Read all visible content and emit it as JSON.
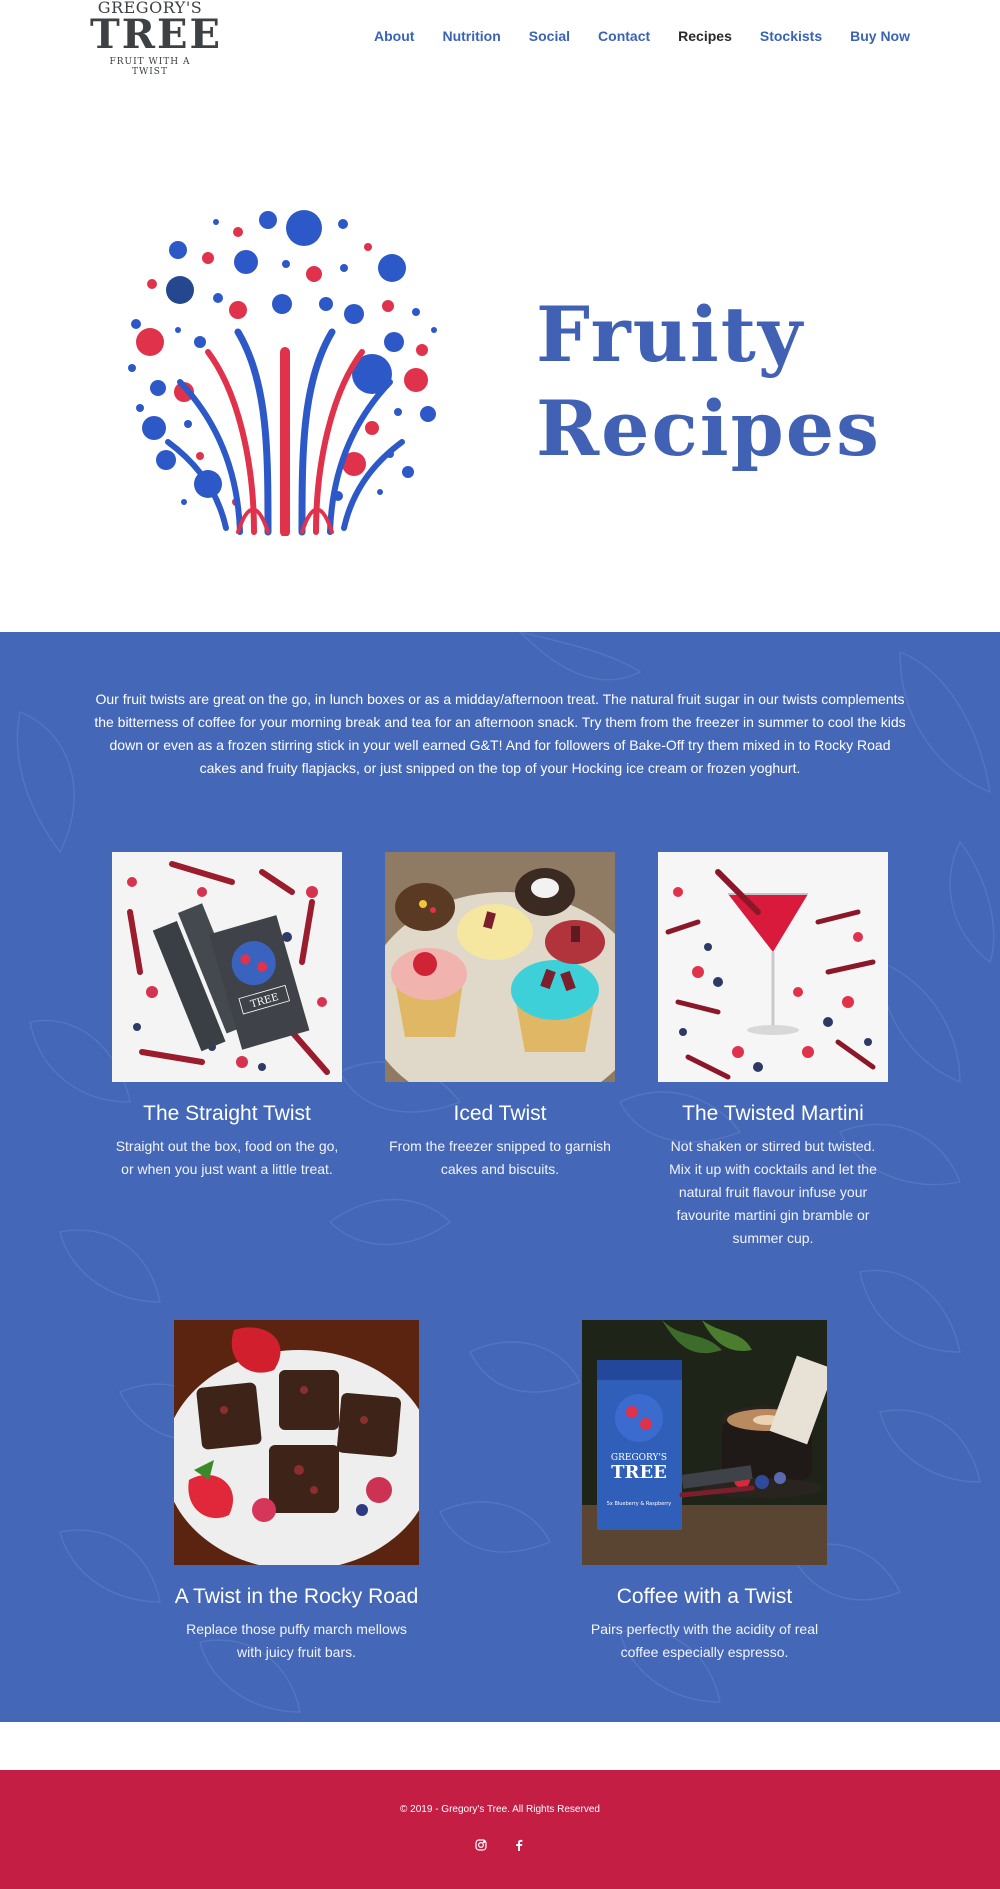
{
  "brand": {
    "name_top": "GREGORY'S",
    "name_main": "TREE",
    "tagline": "FRUIT WITH A TWIST"
  },
  "nav": {
    "items": [
      {
        "label": "About"
      },
      {
        "label": "Nutrition"
      },
      {
        "label": "Social"
      },
      {
        "label": "Contact"
      },
      {
        "label": "Recipes"
      },
      {
        "label": "Stockists"
      },
      {
        "label": "Buy Now"
      }
    ],
    "active": "Recipes"
  },
  "hero": {
    "title_line1": "Fruity",
    "title_line2": "Recipes"
  },
  "intro": {
    "text": "Our fruit twists are great on the go, in lunch boxes or as a midday/afternoon treat. The natural fruit sugar in our twists complements the bitterness of coffee for your morning break and tea for an afternoon snack. Try them from the freezer in summer to cool the kids down or even as a frozen stirring stick in your well earned G&T! And for followers of Bake-Off try them mixed in to Rocky Road cakes and fruity flapjacks, or just snipped on the top of your Hocking ice cream or frozen yoghurt."
  },
  "cards": [
    {
      "title": "The Straight Twist",
      "desc": "Straight out the box, food on the go, or when you just want a little treat."
    },
    {
      "title": "Iced Twist",
      "desc": "From the freezer snipped to garnish cakes and biscuits."
    },
    {
      "title": "The Twisted Martini",
      "desc": "Not shaken or stirred but twisted. Mix it up with cocktails and let the natural fruit flavour infuse your favourite martini gin bramble or summer cup."
    },
    {
      "title": "A Twist in the Rocky Road",
      "desc": "Replace those puffy march mellows with juicy fruit bars."
    },
    {
      "title": "Coffee with a Twist",
      "desc": "Pairs perfectly with the acidity of real coffee especially espresso."
    }
  ],
  "product_box": {
    "brand_top": "GREGORY'S",
    "brand_main": "TREE",
    "flavour": "5x Blueberry & Raspberry"
  },
  "footer": {
    "copyright": "© 2019 - Gregory's Tree. All Rights Reserved",
    "social": [
      "instagram-icon",
      "facebook-icon"
    ]
  },
  "colors": {
    "brand_blue": "#4467b7",
    "title_blue": "#4161b4",
    "footer_red": "#c41e45",
    "berry_red": "#e0324b"
  }
}
